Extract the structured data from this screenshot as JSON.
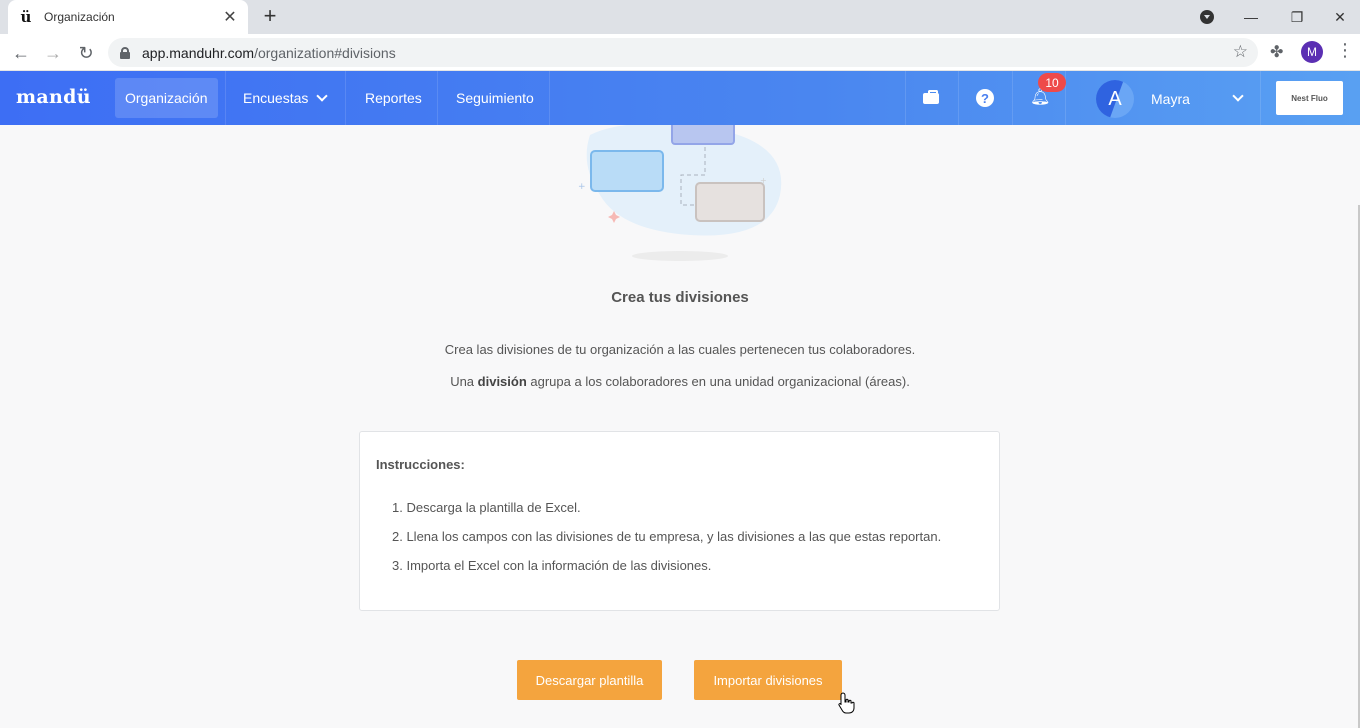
{
  "browser": {
    "tab_title": "Organización",
    "tab_favicon": "ü",
    "url_host": "app.manduhr.com",
    "url_path": "/organization#divisions",
    "profile_initial": "M"
  },
  "navbar": {
    "brand": "mandü",
    "items": [
      {
        "label": "Organización",
        "active": true
      },
      {
        "label": "Encuestas",
        "dropdown": true
      },
      {
        "label": "Reportes"
      },
      {
        "label": "Seguimiento"
      }
    ],
    "notifications_count": "10",
    "user_initial": "A",
    "user_name": "Mayra",
    "company_logo_text": "Nest Fluo"
  },
  "content": {
    "heading": "Crea tus divisiones",
    "desc_line1": "Crea las divisiones de tu organización a las cuales pertenecen tus colaboradores.",
    "desc_line2_pre": "Una ",
    "desc_line2_bold": "división",
    "desc_line2_post": " agrupa a los colaboradores en una unidad organizacional (áreas).",
    "instructions_title": "Instrucciones:",
    "steps": [
      "1. Descarga la plantilla de Excel.",
      "2. Llena los campos con las divisiones de tu empresa, y las divisiones a las que estas reportan.",
      "3. Importa el Excel con la información de las divisiones."
    ],
    "download_button": "Descargar plantilla",
    "import_button": "Importar divisiones"
  },
  "colors": {
    "navbar_start": "#3d6ef4",
    "navbar_end": "#59a0f2",
    "accent_button": "#f4a43e",
    "badge": "#ee4a4a"
  }
}
